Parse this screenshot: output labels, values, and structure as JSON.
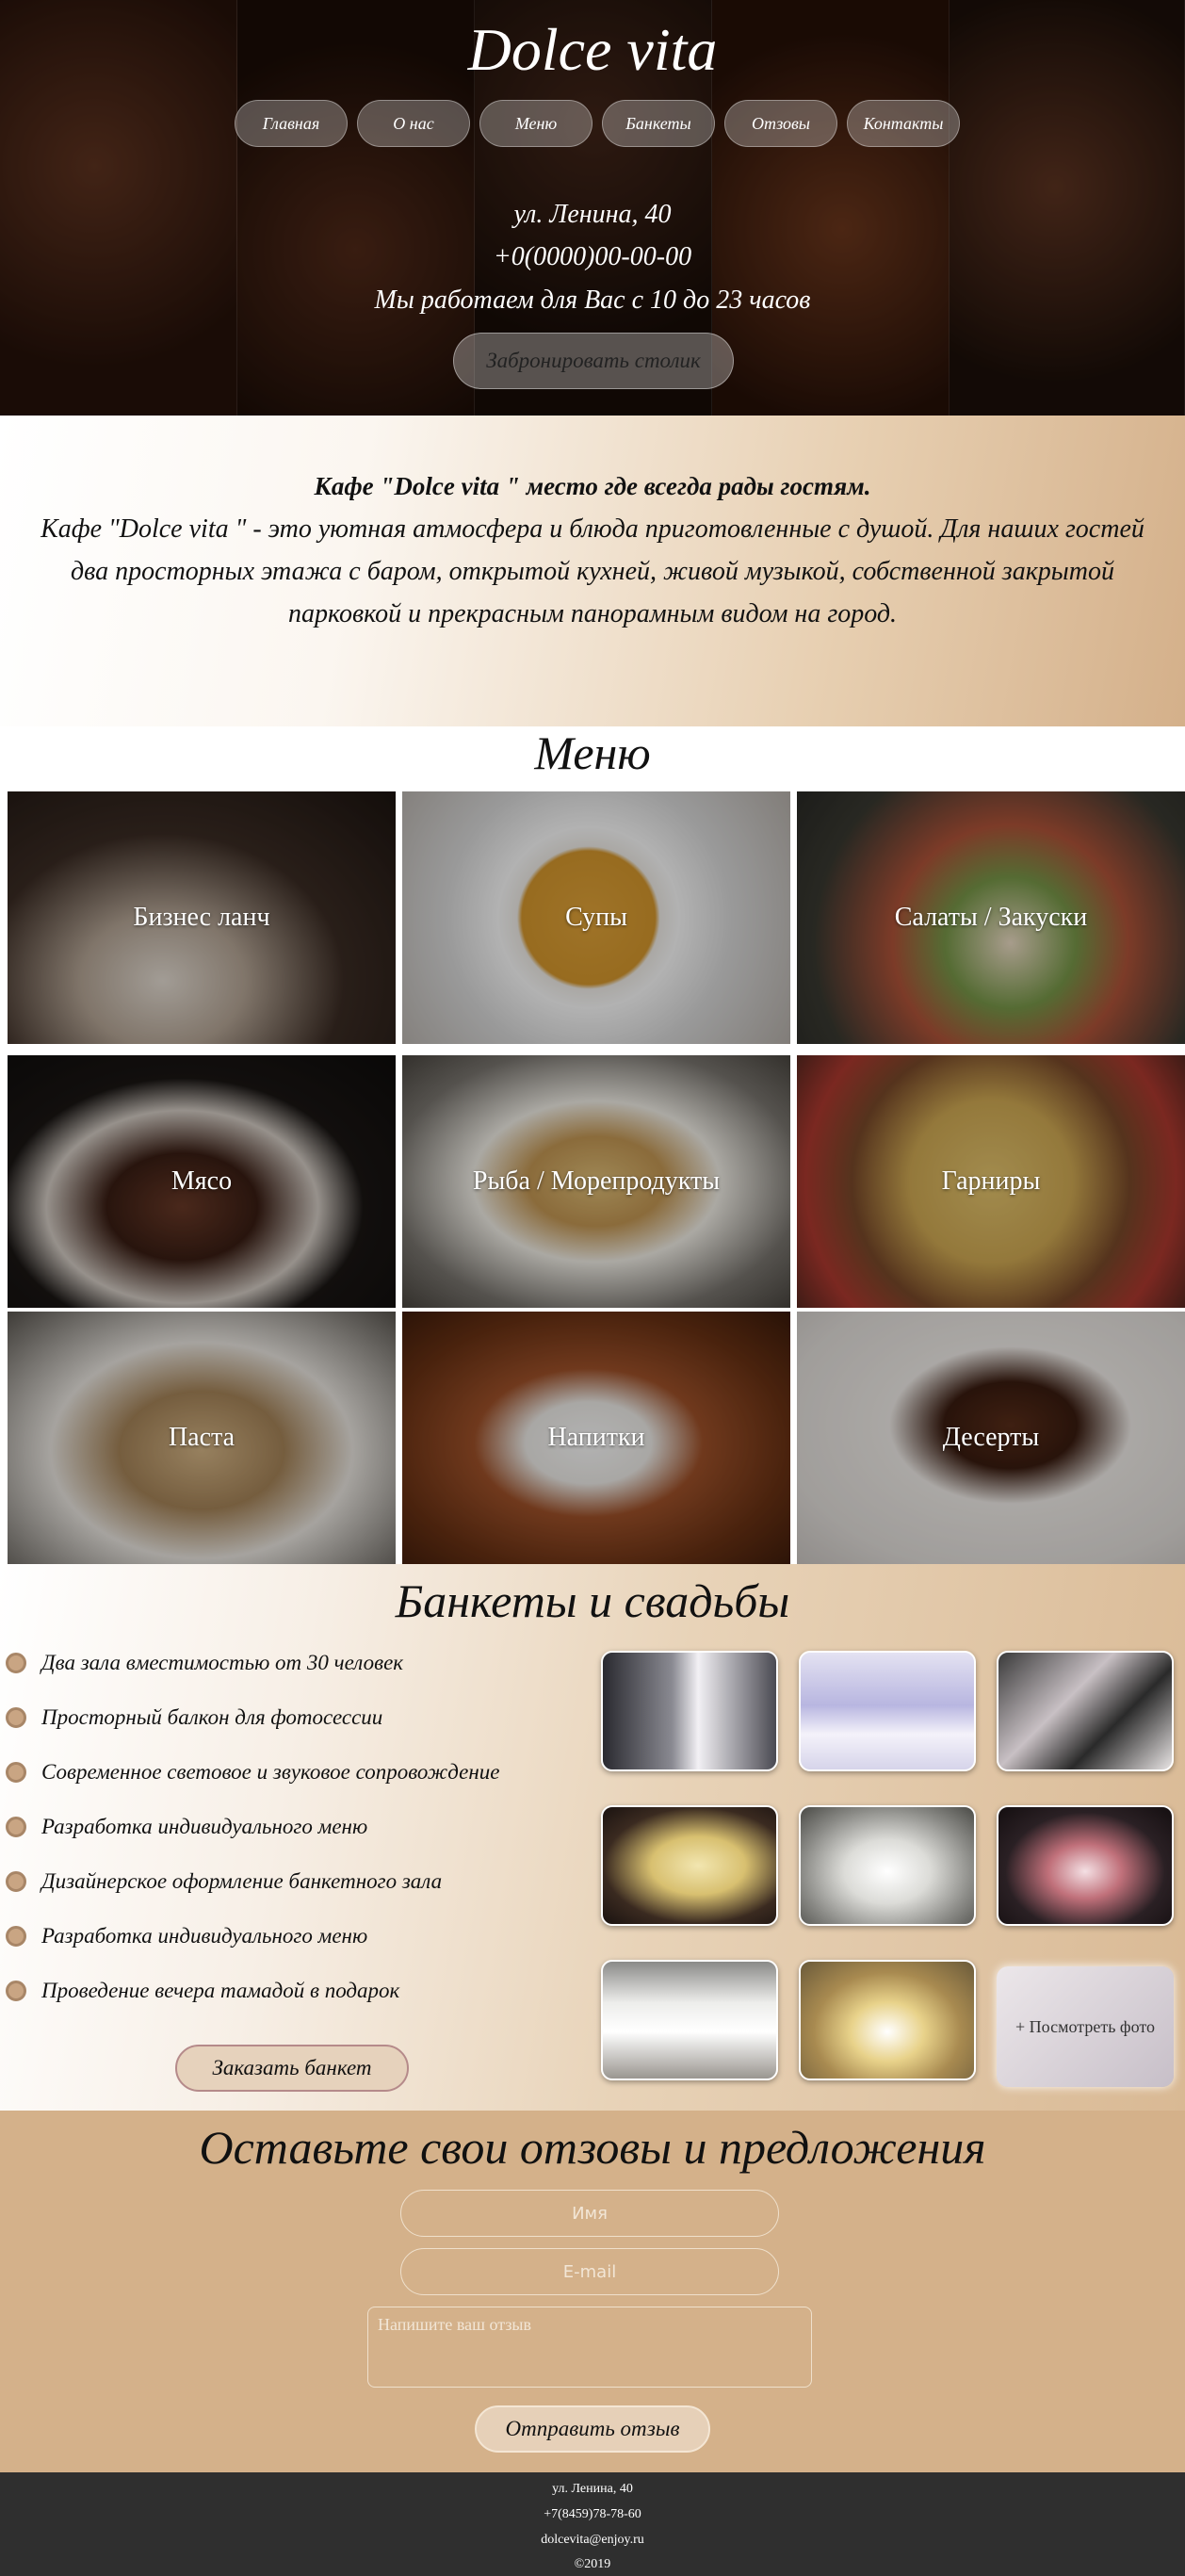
{
  "header": {
    "title": "Dolce vita",
    "nav": [
      "Главная",
      "О нас",
      "Меню",
      "Банкеты",
      "Отзовы",
      "Контакты"
    ],
    "address": "ул. Ленина, 40",
    "phone": "+0(0000)00-00-00",
    "hours": "Мы работаем для Вас с 10 до 23 часов",
    "book_button": "Забронировать столик"
  },
  "about": {
    "heading": "Кафе \"Dolce vita \" место где всегда рады гостям.",
    "text": "Кафе \"Dolce vita \" - это уютная атмосфера и блюда приготовленные с душой. Для наших гостей два просторных этажа с баром, открытой кухней, живой музыкой, собственной закрытой парковкой и прекрасным панорамным видом на город."
  },
  "menu": {
    "title": "Меню",
    "items": [
      {
        "label": "Бизнес ланч",
        "icon": "business-lunch-photo"
      },
      {
        "label": "Супы",
        "icon": "soup-photo"
      },
      {
        "label": "Салаты / Закуски",
        "icon": "salad-photo"
      },
      {
        "label": "Мясо",
        "icon": "meat-photo"
      },
      {
        "label": "Рыба / Морепродукты",
        "icon": "fish-photo"
      },
      {
        "label": "Гарниры",
        "icon": "potatoes-photo"
      },
      {
        "label": "Паста",
        "icon": "pasta-photo"
      },
      {
        "label": "Напитки",
        "icon": "coffee-photo"
      },
      {
        "label": "Десерты",
        "icon": "dessert-photo"
      }
    ]
  },
  "banquets": {
    "title": "Банкеты и свадьбы",
    "features": [
      "Два зала вместимостью от 30 человек",
      "Просторный балкон для фотосессии",
      "Современное световое и звуковое сопровождение",
      "Разработка индивидуального меню",
      "Дизайнерское оформление банкетного зала",
      "Разработка индивидуального меню",
      "Проведение вечера тамадой в подарок"
    ],
    "order_button": "Заказать банкет",
    "more_photos": "+ Посмотреть фото"
  },
  "reviews": {
    "title": "Оставьте свои отзовы и предложения",
    "name_placeholder": "Имя",
    "email_placeholder": "E-mail",
    "review_placeholder": "Напишите ваш отзыв",
    "send_button": "Отправить отзыв"
  },
  "footer": {
    "address": "ул. Ленина, 40",
    "phone": "+7(8459)78-78-60",
    "email": "dolcevita@enjoy.ru",
    "copyright": "©2019"
  }
}
